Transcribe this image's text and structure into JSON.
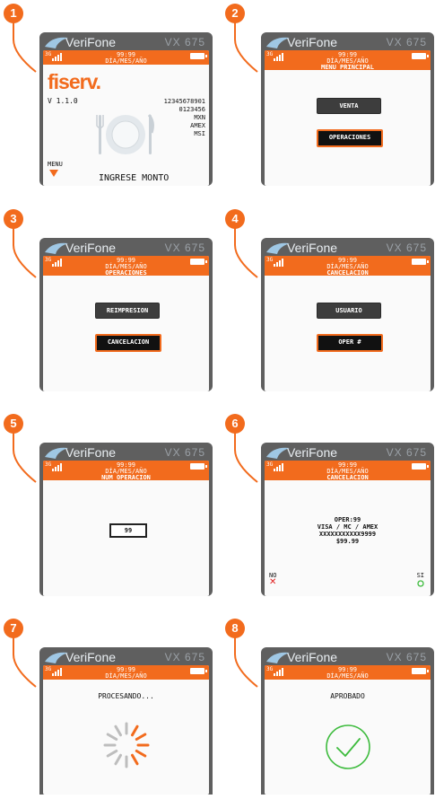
{
  "colors": {
    "accent": "#f26b1d",
    "device": "#5f5f5f",
    "screen": "#fafafa",
    "success": "#3dbb3d",
    "cancel": "#e02020"
  },
  "device": {
    "brand": "VeriFone",
    "model": "VX 675",
    "network": "3G",
    "time": "99:99",
    "date": "DÍA/MES/AÑO"
  },
  "steps": [
    {
      "number": "1",
      "logo": "fiserv.",
      "version": "V 1.1.0",
      "info": [
        "12345678901",
        "0123456",
        "MXN",
        "AMEX",
        "MSI"
      ],
      "menu_label": "MENU",
      "prompt": "INGRESE MONTO",
      "icon": "plate-cutlery-icon"
    },
    {
      "number": "2",
      "title": "MENU PRINCIPAL",
      "buttons": [
        "VENTA",
        "OPERACIONES"
      ]
    },
    {
      "number": "3",
      "title": "OPERACIONES",
      "buttons": [
        "REIMPRESION",
        "CANCELACION"
      ]
    },
    {
      "number": "4",
      "title": "CANCELACION",
      "buttons": [
        "USUARIO",
        "OPER #"
      ]
    },
    {
      "number": "5",
      "title": "NUM OPERACION",
      "input_value": "99"
    },
    {
      "number": "6",
      "title": "CANCELACION",
      "details": [
        "OPER:99",
        "VISA / MC / AMEX",
        "XXXXXXXXXXX9999",
        "$99.99"
      ],
      "no_label": "NO",
      "yes_label": "SI"
    },
    {
      "number": "7",
      "message": "PROCESANDO...",
      "icon": "spinner-icon"
    },
    {
      "number": "8",
      "message": "APROBADO",
      "icon": "checkmark-icon"
    }
  ]
}
